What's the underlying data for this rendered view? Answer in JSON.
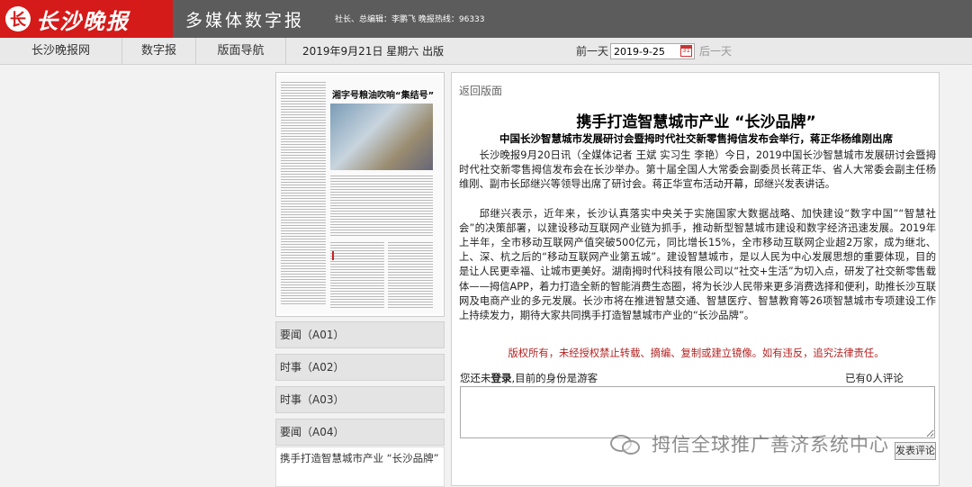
{
  "header": {
    "logo_mark": "长",
    "logo_text": "长沙晚报",
    "title": "多媒体数字报",
    "info": "社长、总编辑：李鹏飞 晚报热线：96333"
  },
  "nav": {
    "items": [
      "长沙晚报网",
      "数字报",
      "版面导航"
    ],
    "date_label": "2019年9月21日 星期六 出版",
    "prev": "前一天",
    "date_value": "2019-9-25",
    "calendar_day": "31",
    "next": "后一天"
  },
  "thumbnail": {
    "headline": "湘字号粮油吹响“集结号”"
  },
  "sections": [
    {
      "label": "要闻（A01）"
    },
    {
      "label": "时事（A02）"
    },
    {
      "label": "时事（A03）"
    },
    {
      "label": "要闻（A04）"
    }
  ],
  "section_article_link": "携手打造智慧城市产业 “长沙品牌”",
  "article": {
    "back": "返回版面",
    "title": "携手打造智慧城市产业 “长沙品牌”",
    "subtitle": "中国长沙智慧城市发展研讨会暨拇时代社交新零售拇信发布会举行，蒋正华杨维刚出席",
    "paragraphs": [
      "长沙晚报9月20日讯（全媒体记者 王斌 实习生 李艳）今日，2019中国长沙智慧城市发展研讨会暨拇时代社交新零售拇信发布会在长沙举办。第十届全国人大常委会副委员长蒋正华、省人大常委会副主任杨维刚、副市长邱继兴等领导出席了研讨会。蒋正华宣布活动开幕，邱继兴发表讲话。",
      "邱继兴表示，近年来，长沙认真落实中央关于实施国家大数据战略、加快建设“数字中国”“智慧社会”的决策部署，以建设移动互联网产业链为抓手，推动新型智慧城市建设和数字经济迅速发展。2019年上半年，全市移动互联网产值突破500亿元，同比增长15%，全市移动互联网企业超2万家，成为继北、上、深、杭之后的“移动互联网产业第五城”。建设智慧城市，是以人民为中心发展思想的重要体现，目的是让人民更幸福、让城市更美好。湖南拇时代科技有限公司以“社交+生活”为切入点，研发了社交新零售载体——拇信APP，着力打造全新的智能消费生态圈，将为长沙人民带来更多消费选择和便利，助推长沙互联网及电商产业的多元发展。长沙市将在推进智慧交通、智慧医疗、智慧教育等26项智慧城市专项建设工作上持续发力，期待大家共同携手打造智慧城市产业的“长沙品牌”。"
    ],
    "copyright": "版权所有，未经授权禁止转载、摘编、复制或建立镜像。如有违反，追究法律责任。"
  },
  "comment": {
    "login_prefix": "您还未",
    "login_word": "登录",
    "login_suffix": ",目前的身份是游客",
    "count": "已有0人评论",
    "submit": "发表评论"
  },
  "watermark": {
    "text": "拇信全球推广善济系统中心"
  }
}
